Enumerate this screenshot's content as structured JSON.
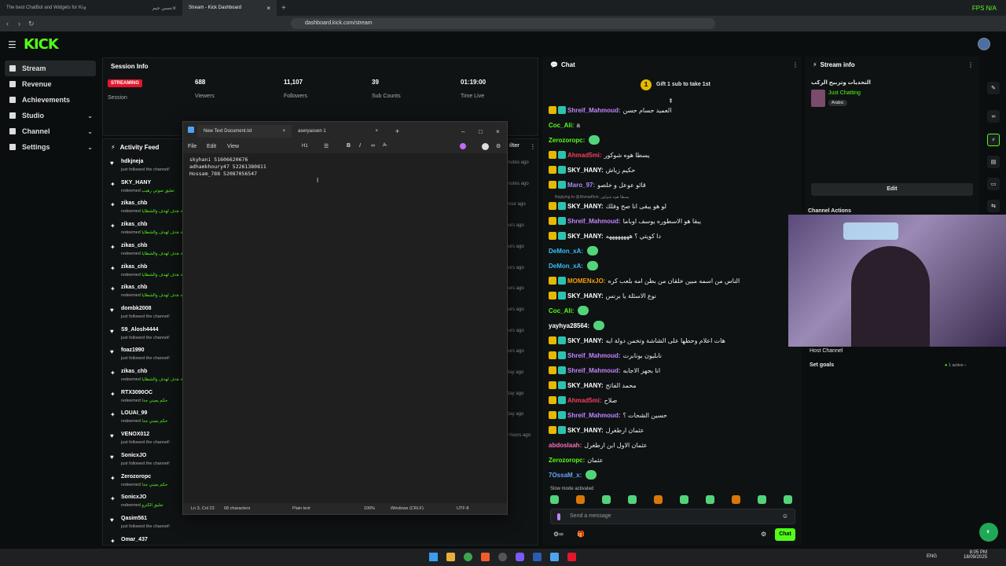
{
  "browser": {
    "tabs": [
      {
        "title": "The best ChatBot and Widgets for Ki"
      },
      {
        "title": "نسبي جيم"
      },
      {
        "title": "Stream - Kick Dashboard"
      }
    ],
    "url": "dashboard.kick.com/stream",
    "fps_label": "FPS N/A"
  },
  "brand": {
    "logo": "KICK",
    "accent": "#53fc18"
  },
  "sidebar": {
    "items": [
      {
        "label": "Stream"
      },
      {
        "label": "Revenue"
      },
      {
        "label": "Achievements"
      },
      {
        "label": "Studio"
      },
      {
        "label": "Channel"
      },
      {
        "label": "Settings"
      }
    ]
  },
  "session": {
    "title": "Session Info",
    "status": "STREAMING",
    "session_label": "Session",
    "stats": [
      {
        "value": "688",
        "label": "Viewers"
      },
      {
        "value": "11,107",
        "label": "Followers"
      },
      {
        "value": "39",
        "label": "Sub Counts"
      },
      {
        "value": "01:19:00",
        "label": "Time Live"
      }
    ]
  },
  "feed": {
    "title": "Activity Feed",
    "filter_label": "ilter",
    "rows": [
      {
        "name": "hdkjneja",
        "desc": "just followed the channel!",
        "extra": ""
      },
      {
        "name": "SKY_HANY",
        "desc": "redeemed",
        "extra": "تعليق صوتي رهيب"
      },
      {
        "name": "zikas_chb",
        "desc": "redeemed",
        "extra": "نسبة هدف لهدف والشطايا"
      },
      {
        "name": "zikas_chb",
        "desc": "redeemed",
        "extra": "نسبة هدف لهدف والشطايا"
      },
      {
        "name": "zikas_chb",
        "desc": "redeemed",
        "extra": "نسبة هدف لهدف والشطايا"
      },
      {
        "name": "zikas_chb",
        "desc": "redeemed",
        "extra": "نسبة هدف لهدف والشطايا"
      },
      {
        "name": "zikas_chb",
        "desc": "redeemed",
        "extra": "نسبة هدف لهدف والشطايا"
      },
      {
        "name": "dombk2008",
        "desc": "just followed the channel!",
        "extra": ""
      },
      {
        "name": "S9_Alosh4444",
        "desc": "just followed the channel!",
        "extra": ""
      },
      {
        "name": "foaz1990",
        "desc": "just followed the channel!",
        "extra": ""
      },
      {
        "name": "zikas_chb",
        "desc": "redeemed",
        "extra": "نسبة هدف لهدف والشطايا"
      },
      {
        "name": "RTX3090OC",
        "desc": "redeemed",
        "extra": "حكم يعيني جدا"
      },
      {
        "name": "LOUAI_99",
        "desc": "redeemed",
        "extra": "حكم يعيني جدا"
      },
      {
        "name": "VENOX012",
        "desc": "just followed the channel!",
        "extra": ""
      },
      {
        "name": "SonicxJO",
        "desc": "just followed the channel!",
        "extra": ""
      },
      {
        "name": "Zerozoropc",
        "desc": "redeemed",
        "extra": "حكم يعيني جدا"
      },
      {
        "name": "SonicxJO",
        "desc": "redeemed",
        "extra": "تعليق الكترو"
      },
      {
        "name": "Qasim561",
        "desc": "just followed the channel!",
        "extra": ""
      },
      {
        "name": "Omar_437",
        "desc": "",
        "extra": ""
      }
    ],
    "times": [
      "minutes ago",
      "minutes ago",
      "1 hour ago",
      "hours ago",
      "hours ago",
      "hours ago",
      "hours ago",
      "hours ago",
      "hours ago",
      "hours ago",
      "1 day ago",
      "1 day ago",
      "1 day ago",
      "20 hours ago"
    ]
  },
  "notepad": {
    "tabs": [
      {
        "title": "New Text Document.txt"
      },
      {
        "title": "aseryassen 1"
      }
    ],
    "menu": [
      "File",
      "Edit",
      "View"
    ],
    "heading_btn": "H1",
    "lines": [
      "skyhani 51606620676",
      "adhamkhoury47 52261380811",
      "Hossam_788 52087056547"
    ],
    "status": {
      "pos": "Ln 3, Col 23",
      "chars": "68 characters",
      "format": "Plain text",
      "zoom": "100%",
      "eol": "Windows (CRLF)",
      "enc": "UTF-8"
    }
  },
  "chat": {
    "title": "Chat",
    "gift_text": "Gift 1 sub to take 1st",
    "messages": [
      {
        "user": "Shreif_Mahmoud",
        "color": "#c084fc",
        "text": "العميد حسام حسن"
      },
      {
        "user": "Coc_Ali",
        "color": "#53fc18",
        "text": "a"
      },
      {
        "user": "Zerozoropc",
        "color": "#53fc18",
        "text": ""
      },
      {
        "user": "Ahmad5mi",
        "color": "#f43f5e",
        "text": "يسطا هوه شوكور"
      },
      {
        "user": "SKY_HANY",
        "color": "#ffffff",
        "text": "حكيم زياش"
      },
      {
        "user": "Maro_97",
        "color": "#a78bfa",
        "text": "قائو عوعل و خلصو"
      },
      {
        "user": "SKY_HANY",
        "color": "#ffffff",
        "text": "لو هو يبقى انا صح وفلك"
      },
      {
        "user": "Shreif_Mahmoud",
        "color": "#c084fc",
        "text": "يبقا هو الاسطوره يوسف اوباما"
      },
      {
        "user": "SKY_HANY",
        "color": "#ffffff",
        "text": "دا كويتي ؟ ههههههههه"
      },
      {
        "user": "DeMon_xA",
        "color": "#38bdf8",
        "text": ""
      },
      {
        "user": "DeMon_xA",
        "color": "#38bdf8",
        "text": ""
      },
      {
        "user": "MOMENxJO",
        "color": "#f59e0b",
        "text": "الناس من اسمه مبين خلقان من بطن امه بلعب كره"
      },
      {
        "user": "SKY_HANY",
        "color": "#ffffff",
        "text": "نوع الاسئلة يا برنس"
      },
      {
        "user": "Coc_Ali",
        "color": "#53fc18",
        "text": ""
      },
      {
        "user": "yayhya28564",
        "color": "#ffffff",
        "text": ""
      },
      {
        "user": "SKY_HANY",
        "color": "#ffffff",
        "text": "هات اعلام وحطها على الشاشة وتخمن دولة ايه"
      },
      {
        "user": "Shreif_Mahmoud",
        "color": "#c084fc",
        "text": "نابليون بونابرت"
      },
      {
        "user": "Shreif_Mahmoud",
        "color": "#c084fc",
        "text": "انا بجهز الاجابه"
      },
      {
        "user": "SKY_HANY",
        "color": "#ffffff",
        "text": "محمد الفاتح"
      },
      {
        "user": "Ahmad5mi",
        "color": "#f43f5e",
        "text": "صلاح"
      },
      {
        "user": "Shreif_Mahmoud",
        "color": "#c084fc",
        "text": "حسين الشحات ؟"
      },
      {
        "user": "SKY_HANY",
        "color": "#ffffff",
        "text": "عثمان ارطغرل"
      },
      {
        "user": "abdoslaah",
        "color": "#f472b6",
        "text": "عثمان الاول ابن ارطغرل"
      },
      {
        "user": "Zerozoropc",
        "color": "#53fc18",
        "text": "عثمان"
      },
      {
        "user": "7OssaM_x",
        "color": "#60a5fa",
        "text": ""
      }
    ],
    "reply_note": "Replying to @Ahmad5mi: يسطا هوه شوكور",
    "slow_mode": "Slow mode activated",
    "input_placeholder": "Send a message",
    "send_label": "Chat"
  },
  "stream_info": {
    "title": "Stream info",
    "stream_title": "التحديات وتربيح الركب",
    "category": "Just Chatting",
    "language": "Arabic",
    "edit_label": "Edit",
    "actions_title": "Channel Actions",
    "host_label": "Host Channel",
    "goals_label": "Set goals",
    "active_label": "1 active"
  },
  "taskbar": {
    "lang": "ENG",
    "time": "8:05 PM",
    "date": "18/09/2025"
  }
}
